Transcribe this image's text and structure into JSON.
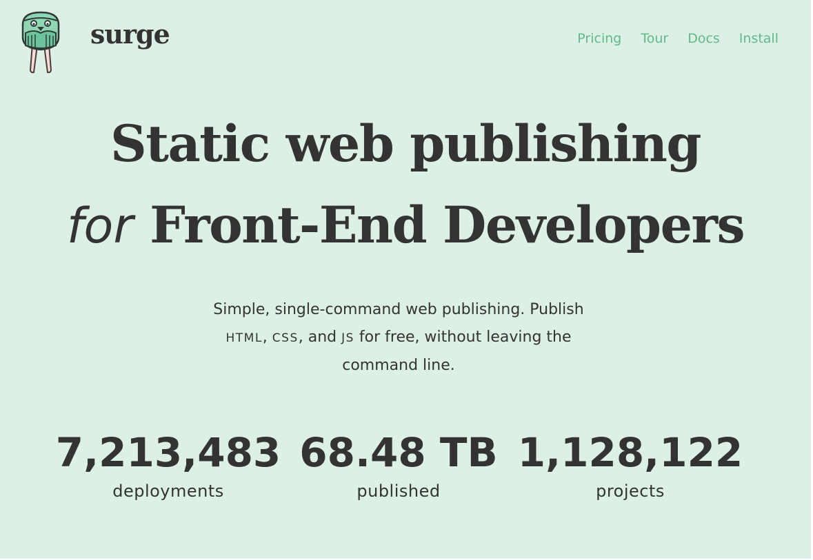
{
  "header": {
    "brand": "surge",
    "nav": [
      "Pricing",
      "Tour",
      "Docs",
      "Install"
    ]
  },
  "hero": {
    "line1": "Static web publishing",
    "line2_italic": "for",
    "line2_rest": "Front-End Developers"
  },
  "subtitle": {
    "part1": "Simple, single-command web publishing. Publish",
    "html": "HTML",
    "sep1": ", ",
    "css": "CSS",
    "sep2": ", and ",
    "js": "JS",
    "part2": " for free, without leaving the",
    "part3": "command line."
  },
  "stats": [
    {
      "value": "7,213,483",
      "label": "deployments"
    },
    {
      "value": "68.48 TB",
      "label": "published"
    },
    {
      "value": "1,128,122",
      "label": "projects"
    }
  ],
  "colors": {
    "background": "#ddf0e5",
    "text": "#333333",
    "link": "#5fb98a",
    "mascot_green": "#8fd6b4",
    "mascot_dark": "#2f3a36",
    "tusk": "#f5dcd8"
  },
  "icons": {
    "logo": "walrus-mascot-icon"
  }
}
